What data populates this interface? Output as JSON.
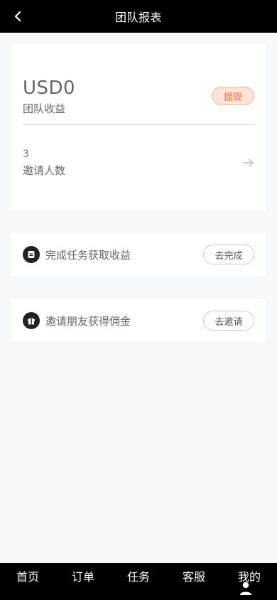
{
  "header": {
    "title": "团队报表",
    "back_icon": "chevron-left-icon"
  },
  "summary": {
    "amount": "USD0",
    "amount_label": "团队收益",
    "withdraw_label": "提现",
    "invite_count": "3",
    "invite_label": "邀请人数",
    "arrow_icon": "arrow-right-icon"
  },
  "actions": [
    {
      "icon": "document-icon",
      "text": "完成任务获取收益",
      "button": "去完成"
    },
    {
      "icon": "gift-icon",
      "text": "邀请朋友获得佣金",
      "button": "去邀请"
    }
  ],
  "nav": {
    "home": "首页",
    "orders": "订单",
    "tasks": "任务",
    "service": "客服",
    "mine": "我的",
    "mine_icon": "user-icon"
  },
  "colors": {
    "header_bg": "#000000",
    "accent": "#ff6b35",
    "withdraw_bg": "#fde3d8",
    "page_bg": "#f7f8fa"
  }
}
